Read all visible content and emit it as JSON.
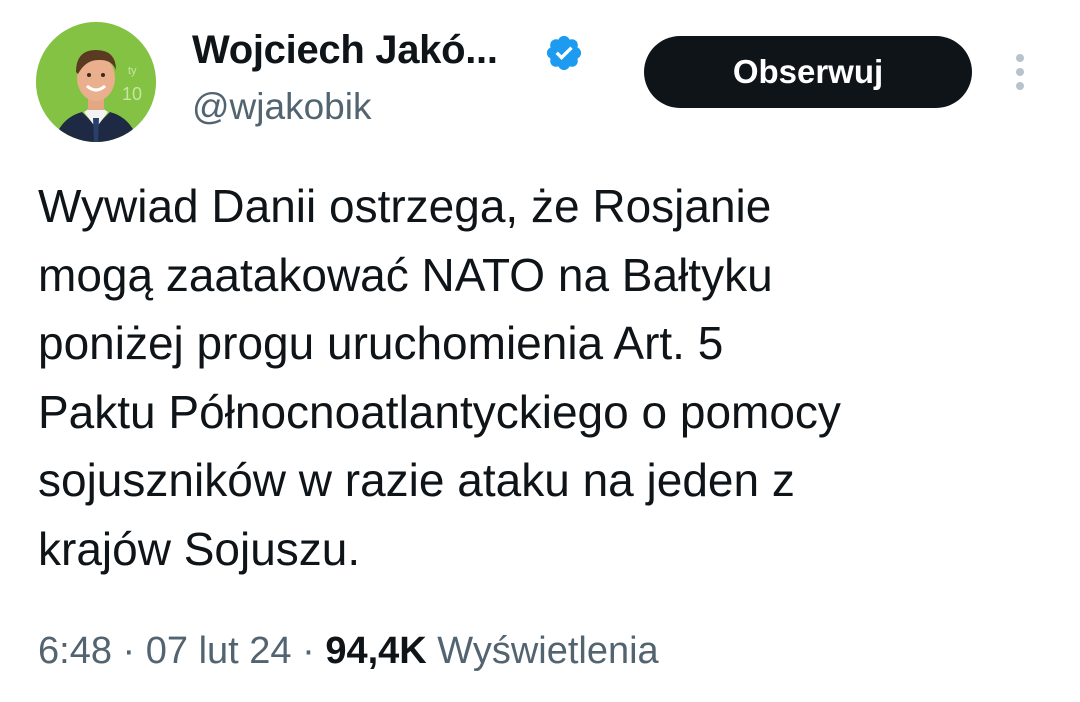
{
  "author": {
    "display_name": "Wojciech Jakó...",
    "handle": "@wjakobik",
    "verified": true,
    "verified_color": "#1d9bf0"
  },
  "actions": {
    "follow_label": "Obserwuj",
    "more_icon": "more-vertical-icon"
  },
  "tweet": {
    "lines": [
      "Wywiad Danii ostrzega, że Rosjanie",
      "mogą zaatakować NATO na Bałtyku",
      "poniżej progu uruchomienia Art. 5",
      "Paktu Północnoatlantyckiego o pomocy",
      "sojuszników w razie ataku na jeden z",
      "krajów Sojuszu."
    ]
  },
  "meta": {
    "time": "6:48",
    "separator": "·",
    "date": "07 lut 24",
    "views_count": "94,4K",
    "views_label": "Wyświetlenia"
  },
  "colors": {
    "text": "#0f1419",
    "secondary": "#536471",
    "button_bg": "#0f1419",
    "avatar_bg": "#7fbf3a"
  }
}
